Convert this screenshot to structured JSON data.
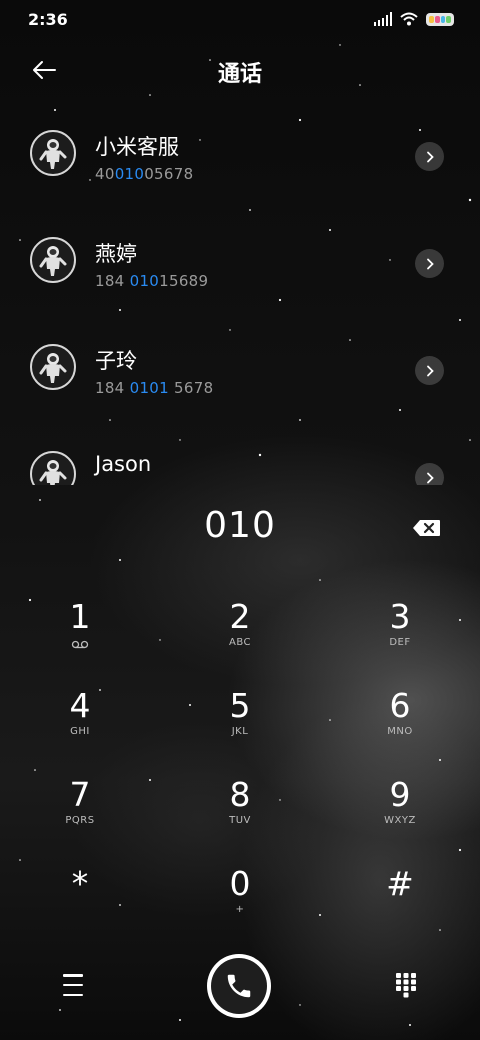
{
  "status_bar": {
    "time": "2:36",
    "icons": [
      "signal-icon",
      "wifi-icon",
      "battery-icon"
    ]
  },
  "header": {
    "title": "通话",
    "back_icon": "arrow-left-icon"
  },
  "contacts": [
    {
      "name": "小米客服",
      "number_before": "40",
      "number_match": "010",
      "number_after": "05678"
    },
    {
      "name": "燕婷",
      "number_before": "184 ",
      "number_match": "010",
      "number_after": "15689"
    },
    {
      "name": "子玲",
      "number_before": "184 ",
      "number_match": "0101",
      "number_after": " 5678"
    },
    {
      "name": "Jason",
      "number_before": "",
      "number_match": "",
      "number_after": ""
    }
  ],
  "dialer": {
    "input_value": "010",
    "backspace_icon": "backspace-icon"
  },
  "keypad": [
    {
      "digit": "1",
      "sub": "voicemail-icon"
    },
    {
      "digit": "2",
      "sub": "ABC"
    },
    {
      "digit": "3",
      "sub": "DEF"
    },
    {
      "digit": "4",
      "sub": "GHI"
    },
    {
      "digit": "5",
      "sub": "JKL"
    },
    {
      "digit": "6",
      "sub": "MNO"
    },
    {
      "digit": "7",
      "sub": "PQRS"
    },
    {
      "digit": "8",
      "sub": "TUV"
    },
    {
      "digit": "9",
      "sub": "WXYZ"
    },
    {
      "digit": "*",
      "sub": ""
    },
    {
      "digit": "0",
      "sub": "+"
    },
    {
      "digit": "#",
      "sub": ""
    }
  ],
  "bottom_bar": {
    "menu_icon": "hamburger-menu-icon",
    "call_icon": "phone-icon",
    "keypad_icon": "dialpad-icon"
  },
  "colors": {
    "highlight": "#2a8bf2",
    "secondary_text": "#9a9a9a"
  }
}
